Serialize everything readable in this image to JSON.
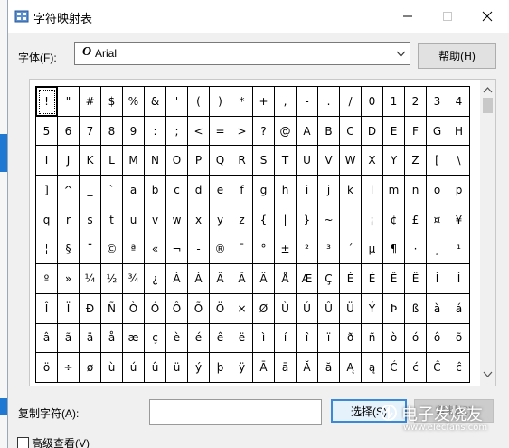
{
  "window": {
    "title": "字符映射表",
    "app_icon": "character-map-icon",
    "caption_buttons": [
      "minimize-icon",
      "maximize-icon",
      "close-icon"
    ]
  },
  "font": {
    "label": "字体(F):",
    "value": "Arial",
    "type_glyph": "O",
    "help_label": "帮助(H)"
  },
  "characters": [
    [
      "!",
      "\"",
      "#",
      "$",
      "%",
      "&",
      "'",
      "(",
      ")",
      "*",
      "+",
      ",",
      "-",
      ".",
      "/",
      "0",
      "1",
      "2",
      "3",
      "4"
    ],
    [
      "5",
      "6",
      "7",
      "8",
      "9",
      ":",
      ";",
      "<",
      "=",
      ">",
      "?",
      "@",
      "A",
      "B",
      "C",
      "D",
      "E",
      "F",
      "G",
      "H"
    ],
    [
      "I",
      "J",
      "K",
      "L",
      "M",
      "N",
      "O",
      "P",
      "Q",
      "R",
      "S",
      "T",
      "U",
      "V",
      "W",
      "X",
      "Y",
      "Z",
      "[",
      "\\"
    ],
    [
      "]",
      "^",
      "_",
      "`",
      "a",
      "b",
      "c",
      "d",
      "e",
      "f",
      "g",
      "h",
      "i",
      "j",
      "k",
      "l",
      "m",
      "n",
      "o",
      "p"
    ],
    [
      "q",
      "r",
      "s",
      "t",
      "u",
      "v",
      "w",
      "x",
      "y",
      "z",
      "{",
      "|",
      "}",
      "~",
      " ",
      "¡",
      "¢",
      "£",
      "¤",
      "¥"
    ],
    [
      "¦",
      "§",
      "¨",
      "©",
      "ª",
      "«",
      "¬",
      "-",
      "®",
      "¯",
      "°",
      "±",
      "²",
      "³",
      "´",
      "µ",
      "¶",
      "·",
      "¸",
      "¹"
    ],
    [
      "º",
      "»",
      "¼",
      "½",
      "¾",
      "¿",
      "À",
      "Á",
      "Â",
      "Ã",
      "Ä",
      "Å",
      "Æ",
      "Ç",
      "È",
      "É",
      "Ê",
      "Ë",
      "Ì",
      "Í"
    ],
    [
      "Î",
      "Ï",
      "Ð",
      "Ñ",
      "Ò",
      "Ó",
      "Ô",
      "Õ",
      "Ö",
      "×",
      "Ø",
      "Ù",
      "Ú",
      "Û",
      "Ü",
      "Ý",
      "Þ",
      "ß",
      "à",
      "á"
    ],
    [
      "â",
      "ã",
      "ä",
      "å",
      "æ",
      "ç",
      "è",
      "é",
      "ê",
      "ë",
      "ì",
      "í",
      "î",
      "ï",
      "ð",
      "ñ",
      "ò",
      "ó",
      "ô",
      "õ"
    ],
    [
      "ö",
      "÷",
      "ø",
      "ù",
      "ú",
      "û",
      "ü",
      "ý",
      "þ",
      "ÿ",
      "Ā",
      "ā",
      "Ă",
      "ă",
      "Ą",
      "ą",
      "Ć",
      "ć",
      "Ĉ",
      "ĉ"
    ]
  ],
  "selected_character": "!",
  "copy": {
    "label": "复制字符(A):",
    "value": "",
    "select_label": "选择(S)",
    "copy_label": "复制(C)"
  },
  "advanced_view": {
    "label": "高级查看(V)",
    "checked": false
  },
  "watermark": {
    "text": "电子发烧友",
    "url": "www.elecfans.com"
  },
  "colors": {
    "accent": "#3a89d8",
    "window_bg": "#f0f0f0",
    "taskbar_blue": "#1f78d1"
  }
}
